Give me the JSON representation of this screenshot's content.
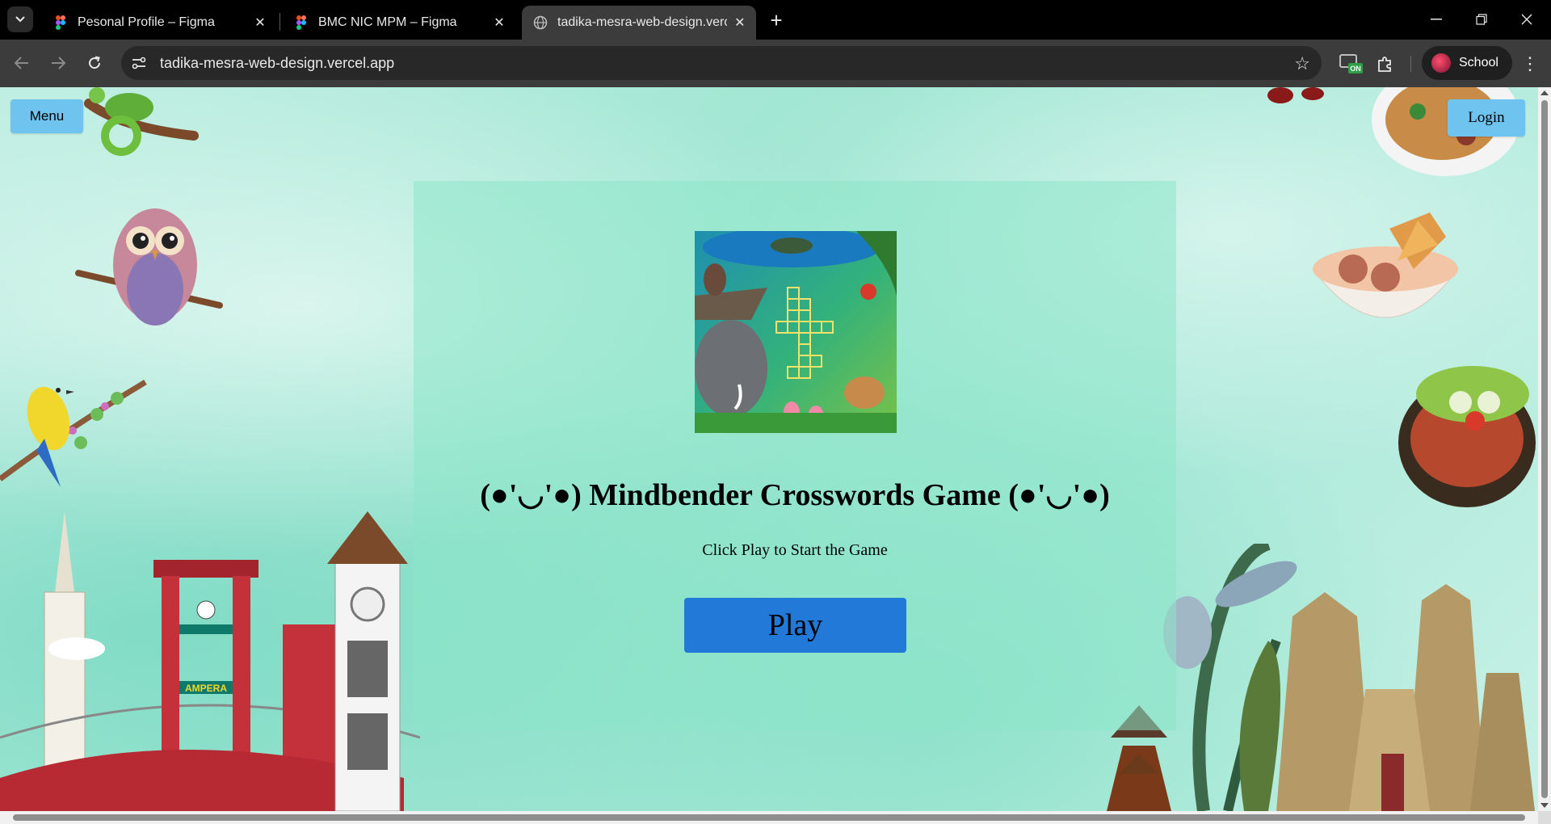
{
  "browser": {
    "tabs": [
      {
        "title": "Pesonal Profile – Figma",
        "favicon": "figma-icon",
        "active": false
      },
      {
        "title": "BMC NIC MPM – Figma",
        "favicon": "figma-icon",
        "active": false
      },
      {
        "title": "tadika-mesra-web-design.vercel.app",
        "favicon": "globe-icon",
        "active": true
      }
    ],
    "url": "tadika-mesra-web-design.vercel.app",
    "profile_label": "School",
    "extension_badge": "ON"
  },
  "page": {
    "menu_label": "Menu",
    "login_label": "Login",
    "title": "(●'◡'●) Mindbender Crosswords Game (●'◡'●)",
    "subtitle": "Click Play to Start the Game",
    "play_label": "Play",
    "sign_text": "AMPERA"
  },
  "colors": {
    "button_blue": "#6ec3ef",
    "play_blue": "#2379d7",
    "background_mint": "#9ee6d1"
  }
}
